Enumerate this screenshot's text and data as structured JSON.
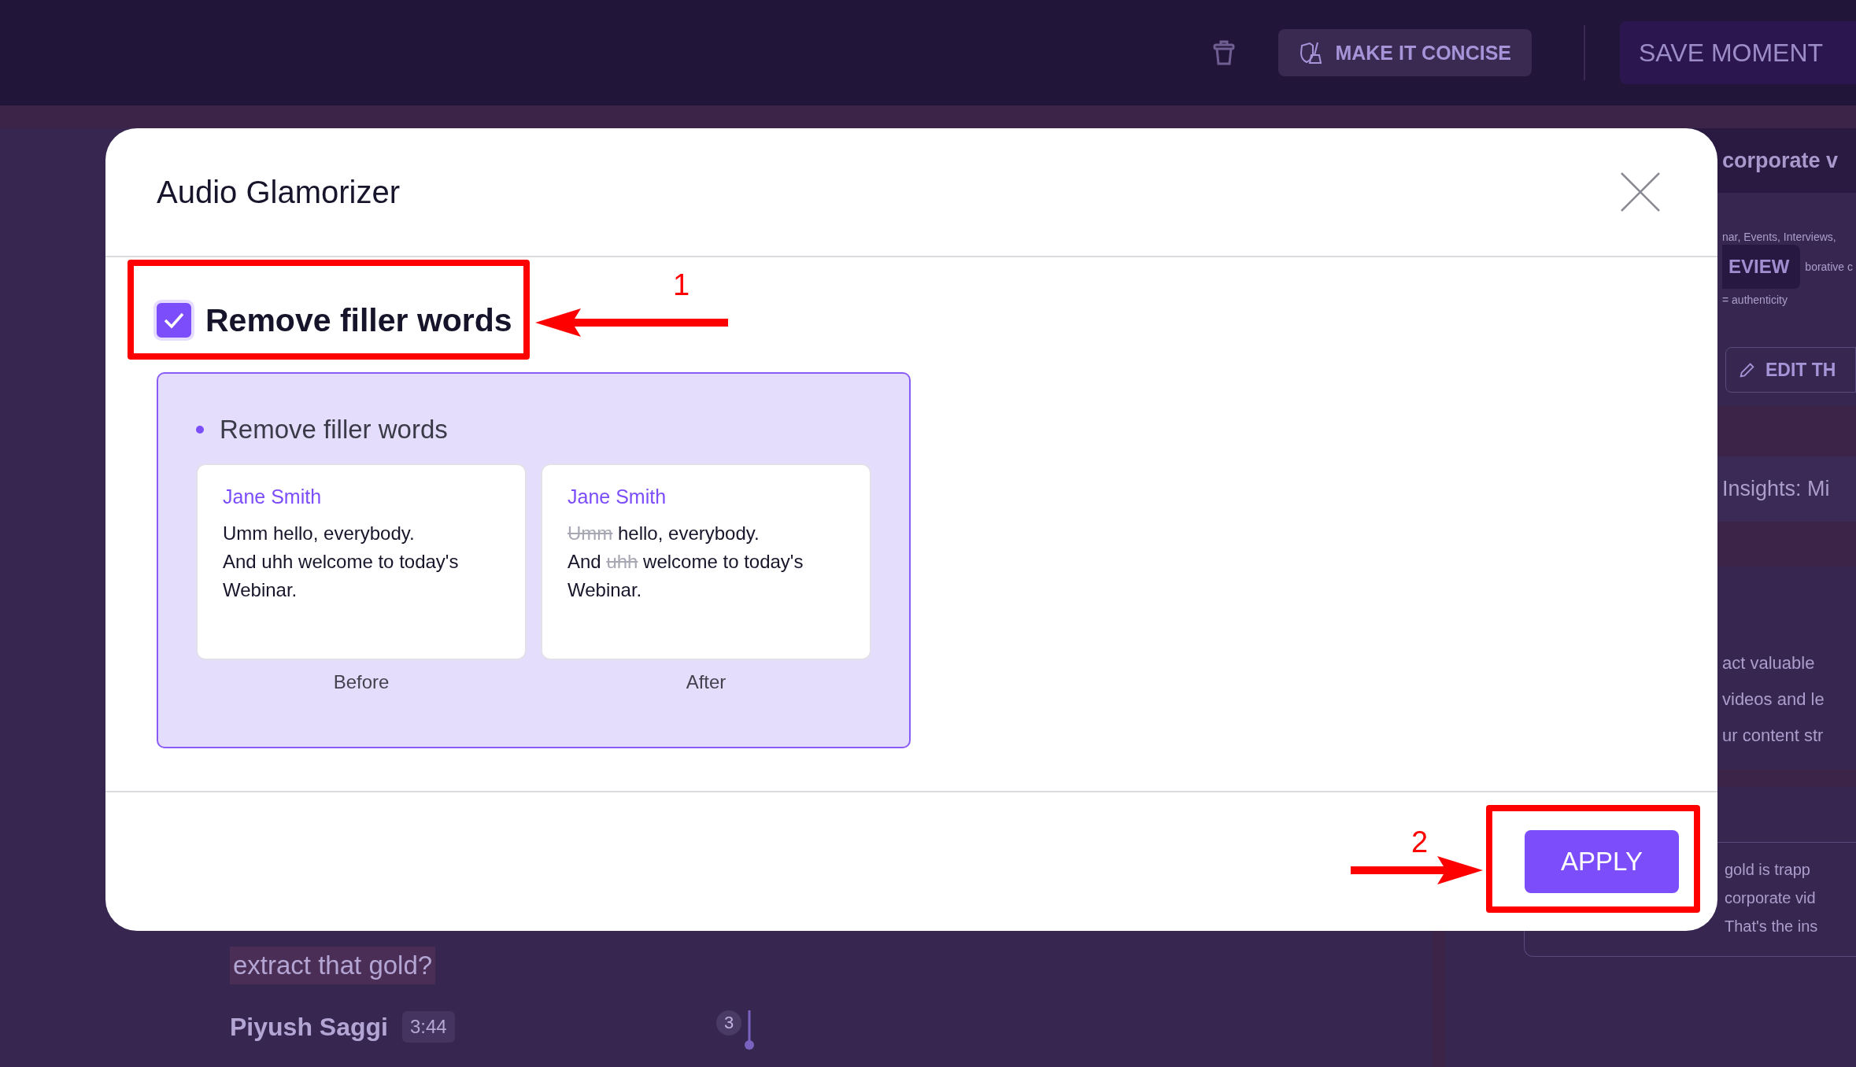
{
  "top_bar": {
    "concise_button": "MAKE IT CONCISE",
    "save_button": "SAVE MOMENT"
  },
  "transcript": {
    "highlight": "extract that gold?",
    "speaker": "Piyush Saggi",
    "time": "3:44",
    "marker": "3"
  },
  "side_panel": {
    "title": "corporate v",
    "tags": "nar, Events, Interviews,",
    "review_button": "EVIEW",
    "review_note": "borative c",
    "formula": "= authenticity",
    "edit_button": "EDIT TH",
    "insights_title": "Insights: Mi",
    "body_lines": [
      "act valuable",
      "videos and le",
      "ur content str"
    ],
    "quote_lines": [
      "gold is trapp",
      "corporate vid",
      "That's the ins"
    ]
  },
  "dialog": {
    "title": "Audio Glamorizer",
    "option": {
      "label": "Remove filler words",
      "checked": true
    },
    "preview": {
      "bullet": "Remove filler words",
      "examples": [
        {
          "speaker": "Jane Smith",
          "caption": "Before",
          "lines": [
            [
              {
                "text": "Umm hello, everybody.",
                "struck": false
              }
            ],
            [
              {
                "text": "And uhh welcome to today's",
                "struck": false
              }
            ],
            [
              {
                "text": "Webinar.",
                "struck": false
              }
            ]
          ]
        },
        {
          "speaker": "Jane Smith",
          "caption": "After",
          "lines": [
            [
              {
                "text": "Umm",
                "struck": true
              },
              {
                "text": " hello, everybody.",
                "struck": false
              }
            ],
            [
              {
                "text": "And ",
                "struck": false
              },
              {
                "text": "uhh",
                "struck": true
              },
              {
                "text": " welcome to today's",
                "struck": false
              }
            ],
            [
              {
                "text": "Webinar.",
                "struck": false
              }
            ]
          ]
        }
      ]
    },
    "apply_button": "APPLY"
  },
  "annotations": [
    {
      "number": "1"
    },
    {
      "number": "2"
    }
  ]
}
